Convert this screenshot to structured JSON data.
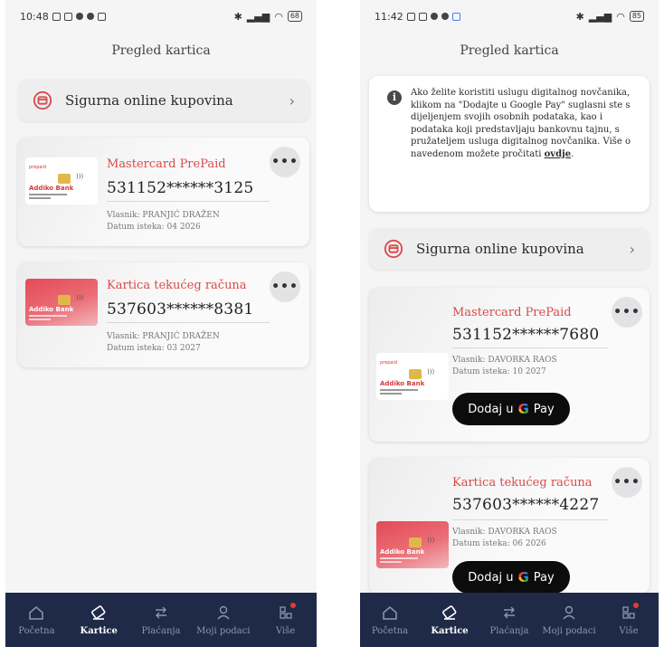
{
  "screens": [
    {
      "status": {
        "time": "10:48",
        "battery": "68"
      },
      "page_title": "Pregled kartica",
      "shop": {
        "label": "Sigurna online kupovina"
      },
      "cards": [
        {
          "title": "Mastercard PrePaid",
          "number": "531152******3125",
          "owner": "Vlasnik: PRANJIĆ DRAŽEN",
          "expiry": "Datum isteka: 04 2026",
          "thumb_brand": "Addiko Bank",
          "thumb_label": "prepaid",
          "thumb_style": "white"
        },
        {
          "title": "Kartica tekućeg računa",
          "number": "537603******8381",
          "owner": "Vlasnik: PRANJIĆ DRAŽEN",
          "expiry": "Datum isteka: 03 2027",
          "thumb_brand": "Addiko Bank",
          "thumb_style": "red"
        }
      ]
    },
    {
      "status": {
        "time": "11:42",
        "battery": "85"
      },
      "page_title": "Pregled kartica",
      "info": {
        "text": "Ako želite koristiti uslugu digitalnog novčanika, klikom na \"Dodajte u Google Pay\" suglasni ste s dijeljenjem svojih osobnih podataka, kao i podataka koji predstavljaju bankovnu tajnu, s pružateljem usluga digitalnog novčanika. Više o navedenom možete pročitati",
        "link": "ovdje",
        "end": "."
      },
      "shop": {
        "label": "Sigurna online kupovina"
      },
      "cards": [
        {
          "title": "Mastercard PrePaid",
          "number": "531152******7680",
          "owner": "Vlasnik: DAVORKA RAOS",
          "expiry": "Datum isteka: 10 2027",
          "thumb_brand": "Addiko Bank",
          "thumb_label": "prepaid",
          "thumb_style": "white",
          "gpay_prefix": "Dodaj u",
          "gpay_brand": "G",
          "gpay_suffix": "Pay"
        },
        {
          "title": "Kartica tekućeg računa",
          "number": "537603******4227",
          "owner": "Vlasnik: DAVORKA RAOS",
          "expiry": "Datum isteka: 06 2026",
          "thumb_brand": "Addiko Bank",
          "thumb_style": "red",
          "gpay_prefix": "Dodaj u",
          "gpay_brand": "G",
          "gpay_suffix": "Pay"
        }
      ]
    }
  ],
  "nav": [
    {
      "label": "Početna",
      "icon": "home-icon"
    },
    {
      "label": "Kartice",
      "icon": "card-icon",
      "active": true
    },
    {
      "label": "Plaćanja",
      "icon": "transfer-icon"
    },
    {
      "label": "Moji podaci",
      "icon": "user-icon"
    },
    {
      "label": "Više",
      "icon": "more-grid-icon",
      "badge": true
    }
  ],
  "colors": {
    "accent": "#d84b4b",
    "nav_bg": "#1e2a47",
    "gpay_bg": "#0c0c0c"
  }
}
